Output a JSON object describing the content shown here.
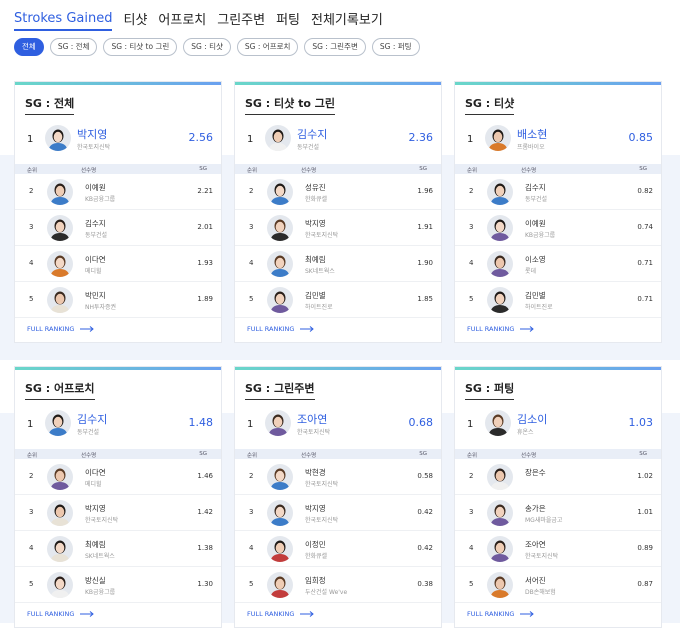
{
  "nav": {
    "tabs": [
      {
        "label": "Strokes Gained"
      },
      {
        "label": "티샷"
      },
      {
        "label": "어프로치"
      },
      {
        "label": "그린주변"
      },
      {
        "label": "퍼팅"
      },
      {
        "label": "전체기록보기"
      }
    ]
  },
  "filters": [
    {
      "label": "전체"
    },
    {
      "label": "SG : 전체"
    },
    {
      "label": "SG : 티샷 to 그린"
    },
    {
      "label": "SG : 티샷"
    },
    {
      "label": "SG : 어프로치"
    },
    {
      "label": "SG : 그린주변"
    },
    {
      "label": "SG : 퍼팅"
    }
  ],
  "table_header": {
    "rank": "순위",
    "player": "선수명",
    "sg": "SG"
  },
  "full_ranking_label": "FULL RANKING",
  "colors": {
    "accent": "#2f5fe0",
    "band": "#f0f4fb"
  },
  "cards": [
    {
      "title": "SG : 전체",
      "leader": {
        "rank": "1",
        "name": "박지영",
        "team": "한국토지신탁",
        "score": "2.56"
      },
      "rows": [
        {
          "rank": "2",
          "name": "이예원",
          "team": "KB금융그룹",
          "score": "2.21"
        },
        {
          "rank": "3",
          "name": "김수지",
          "team": "동부건설",
          "score": "2.01"
        },
        {
          "rank": "4",
          "name": "이다연",
          "team": "메디힐",
          "score": "1.93"
        },
        {
          "rank": "5",
          "name": "박민지",
          "team": "NH투자증권",
          "score": "1.89"
        }
      ]
    },
    {
      "title": "SG : 티샷 to 그린",
      "leader": {
        "rank": "1",
        "name": "김수지",
        "team": "동부건설",
        "score": "2.36"
      },
      "rows": [
        {
          "rank": "2",
          "name": "성유진",
          "team": "한화큐셀",
          "score": "1.96"
        },
        {
          "rank": "3",
          "name": "박지영",
          "team": "한국토지신탁",
          "score": "1.91"
        },
        {
          "rank": "4",
          "name": "최예림",
          "team": "SK네트웍스",
          "score": "1.90"
        },
        {
          "rank": "5",
          "name": "김민별",
          "team": "하이트진로",
          "score": "1.85"
        }
      ]
    },
    {
      "title": "SG : 티샷",
      "leader": {
        "rank": "1",
        "name": "배소현",
        "team": "프롬바이오",
        "score": "0.85"
      },
      "rows": [
        {
          "rank": "2",
          "name": "김수지",
          "team": "동부건설",
          "score": "0.82"
        },
        {
          "rank": "3",
          "name": "이예원",
          "team": "KB금융그룹",
          "score": "0.74"
        },
        {
          "rank": "4",
          "name": "이소영",
          "team": "롯데",
          "score": "0.71"
        },
        {
          "rank": "5",
          "name": "김민별",
          "team": "하이트진로",
          "score": "0.71"
        }
      ]
    },
    {
      "title": "SG : 어프로치",
      "leader": {
        "rank": "1",
        "name": "김수지",
        "team": "동부건설",
        "score": "1.48"
      },
      "rows": [
        {
          "rank": "2",
          "name": "이다연",
          "team": "메디힐",
          "score": "1.46"
        },
        {
          "rank": "3",
          "name": "박지영",
          "team": "한국토지신탁",
          "score": "1.42"
        },
        {
          "rank": "4",
          "name": "최예림",
          "team": "SK네트웍스",
          "score": "1.38"
        },
        {
          "rank": "5",
          "name": "방신실",
          "team": "KB금융그룹",
          "score": "1.30"
        }
      ]
    },
    {
      "title": "SG : 그린주변",
      "leader": {
        "rank": "1",
        "name": "조아연",
        "team": "한국토지신탁",
        "score": "0.68"
      },
      "rows": [
        {
          "rank": "2",
          "name": "박현경",
          "team": "한국토지신탁",
          "score": "0.58"
        },
        {
          "rank": "3",
          "name": "박지영",
          "team": "한국토지신탁",
          "score": "0.42"
        },
        {
          "rank": "4",
          "name": "이정민",
          "team": "한화큐셀",
          "score": "0.42"
        },
        {
          "rank": "5",
          "name": "임희정",
          "team": "두산건설 We've",
          "score": "0.38"
        }
      ]
    },
    {
      "title": "SG : 퍼팅",
      "leader": {
        "rank": "1",
        "name": "김소이",
        "team": "휴온스",
        "score": "1.03"
      },
      "rows": [
        {
          "rank": "2",
          "name": "장은수",
          "team": "",
          "score": "1.02"
        },
        {
          "rank": "3",
          "name": "송가은",
          "team": "MG새마을금고",
          "score": "1.01"
        },
        {
          "rank": "4",
          "name": "조아연",
          "team": "한국토지신탁",
          "score": "0.89"
        },
        {
          "rank": "5",
          "name": "서어진",
          "team": "DB손해보험",
          "score": "0.87"
        }
      ]
    }
  ]
}
